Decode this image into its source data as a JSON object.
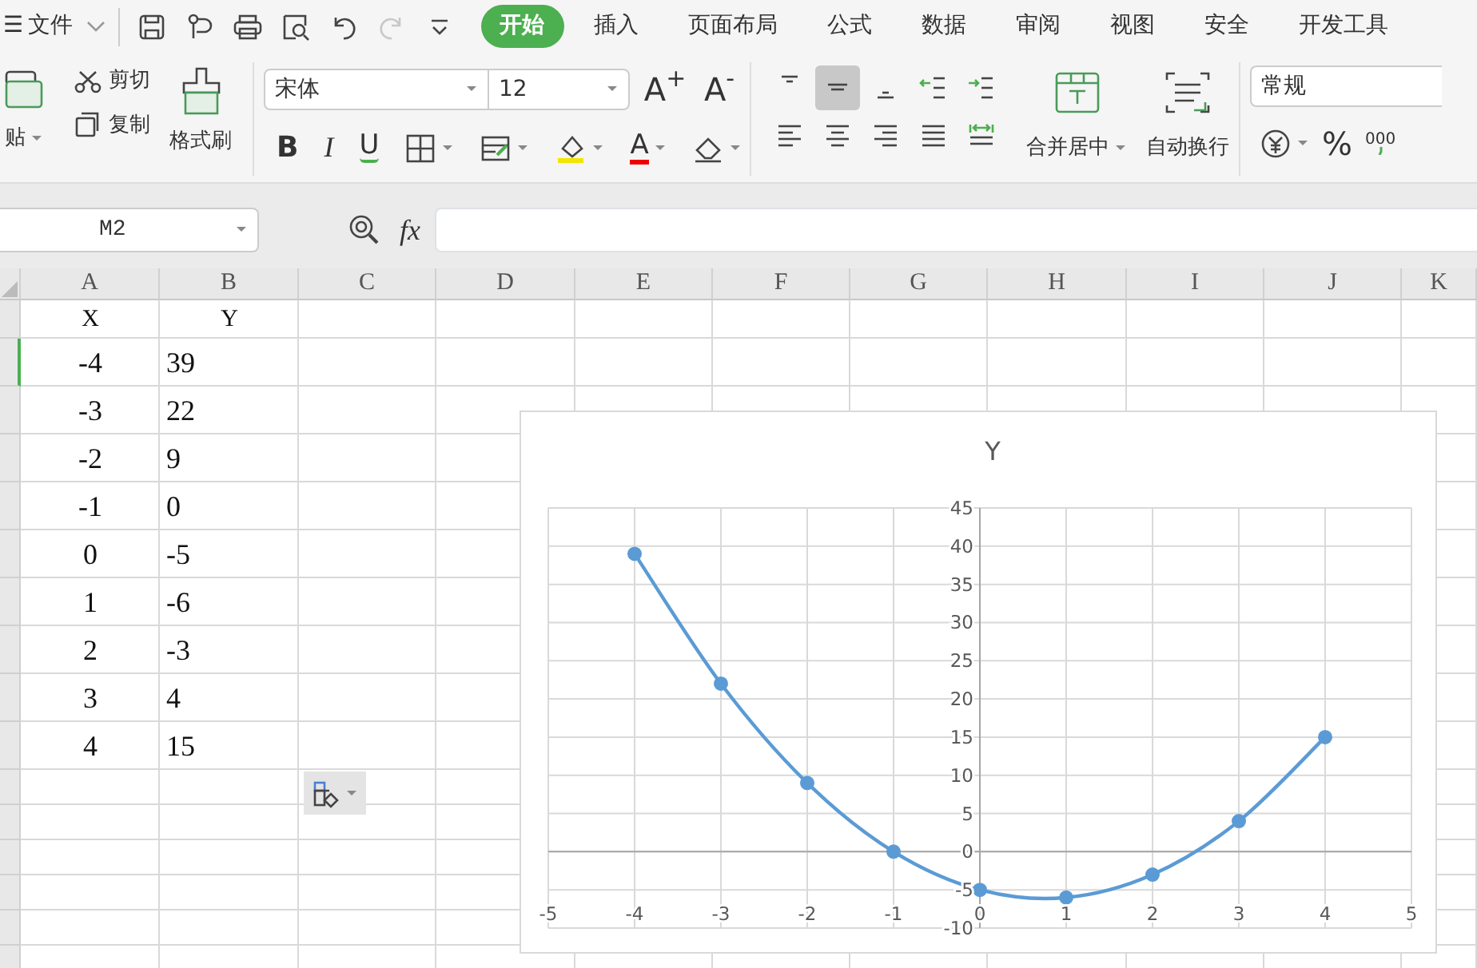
{
  "title_bar": {
    "menu_icon": "☰",
    "file_menu": "文件"
  },
  "quick_access": [
    {
      "kind": "save",
      "disabled": false
    },
    {
      "kind": "export",
      "disabled": false
    },
    {
      "kind": "print",
      "disabled": false
    },
    {
      "kind": "preview",
      "disabled": false
    },
    {
      "kind": "undo",
      "disabled": false
    },
    {
      "kind": "redo",
      "disabled": true
    },
    {
      "kind": "customize",
      "disabled": false
    }
  ],
  "tabs": [
    {
      "label": "开始",
      "selected": true
    },
    {
      "label": "插入",
      "selected": false
    },
    {
      "label": "页面布局",
      "selected": false
    },
    {
      "label": "公式",
      "selected": false
    },
    {
      "label": "数据",
      "selected": false
    },
    {
      "label": "审阅",
      "selected": false
    },
    {
      "label": "视图",
      "selected": false
    },
    {
      "label": "安全",
      "selected": false
    },
    {
      "label": "开发工具",
      "selected": false
    }
  ],
  "ribbon": {
    "paste": "贴",
    "cut": "剪切",
    "copy": "复制",
    "format_painter": "格式刷",
    "font_name": "宋体",
    "font_size": "12",
    "increase_font": "A$^{+}$",
    "decrease_font": "A$^{-}$",
    "bold": "B",
    "italic": "I",
    "underline": "U",
    "font_color": "A",
    "align_buttons": [
      {
        "kind": "top",
        "selected": false
      },
      {
        "kind": "middle",
        "selected": true
      },
      {
        "kind": "bottom",
        "selected": false
      },
      {
        "kind": "outdent",
        "selected": false
      },
      {
        "kind": "indent",
        "selected": false
      },
      {
        "kind": "left",
        "selected": false
      },
      {
        "kind": "center",
        "selected": false
      },
      {
        "kind": "right",
        "selected": false
      },
      {
        "kind": "justify",
        "selected": false
      },
      {
        "kind": "distribute",
        "selected": false
      }
    ],
    "merge": "合并居中",
    "wrap_text": "自动换行",
    "number_format": "常规",
    "percent": "%",
    "thousands": "000"
  },
  "formula_bar": {
    "name_box": "M2",
    "fx": "fx"
  },
  "sheet": {
    "columns": [
      "A",
      "B",
      "C",
      "D",
      "E",
      "F",
      "G",
      "H",
      "I",
      "J",
      "K"
    ],
    "rows": [
      {
        "cells": [
          "X",
          "Y"
        ],
        "selected": false
      },
      {
        "cells": [
          "-4",
          "39"
        ],
        "selected": true
      },
      {
        "cells": [
          "-3",
          "22"
        ],
        "selected": false
      },
      {
        "cells": [
          "-2",
          "9"
        ],
        "selected": false
      },
      {
        "cells": [
          "-1",
          "0"
        ],
        "selected": false
      },
      {
        "cells": [
          "0",
          "-5"
        ],
        "selected": false
      },
      {
        "cells": [
          "1",
          "-6"
        ],
        "selected": false
      },
      {
        "cells": [
          "2",
          "-3"
        ],
        "selected": false
      },
      {
        "cells": [
          "3",
          "4"
        ],
        "selected": false
      },
      {
        "cells": [
          "4",
          "15"
        ],
        "selected": false
      }
    ]
  },
  "chart": {
    "chart_data": {
      "type": "line",
      "grid": true,
      "x": [
        -4,
        -3,
        -2,
        -1,
        0,
        1,
        2,
        3,
        4
      ],
      "series": [
        {
          "name": "Y",
          "color": "#5b9bd5",
          "marker": "circle",
          "values": [
            39,
            22,
            9,
            0,
            -5,
            -6,
            -3,
            4,
            15
          ]
        }
      ],
      "xlim": [
        -5,
        5
      ],
      "ylim": [
        -10,
        45
      ],
      "xticks": [
        -5,
        -4,
        -3,
        -2,
        -1,
        0,
        1,
        2,
        3,
        4,
        5
      ],
      "yticks": [
        -10,
        -5,
        0,
        5,
        10,
        15,
        20,
        25,
        30,
        35,
        40,
        45
      ]
    }
  }
}
